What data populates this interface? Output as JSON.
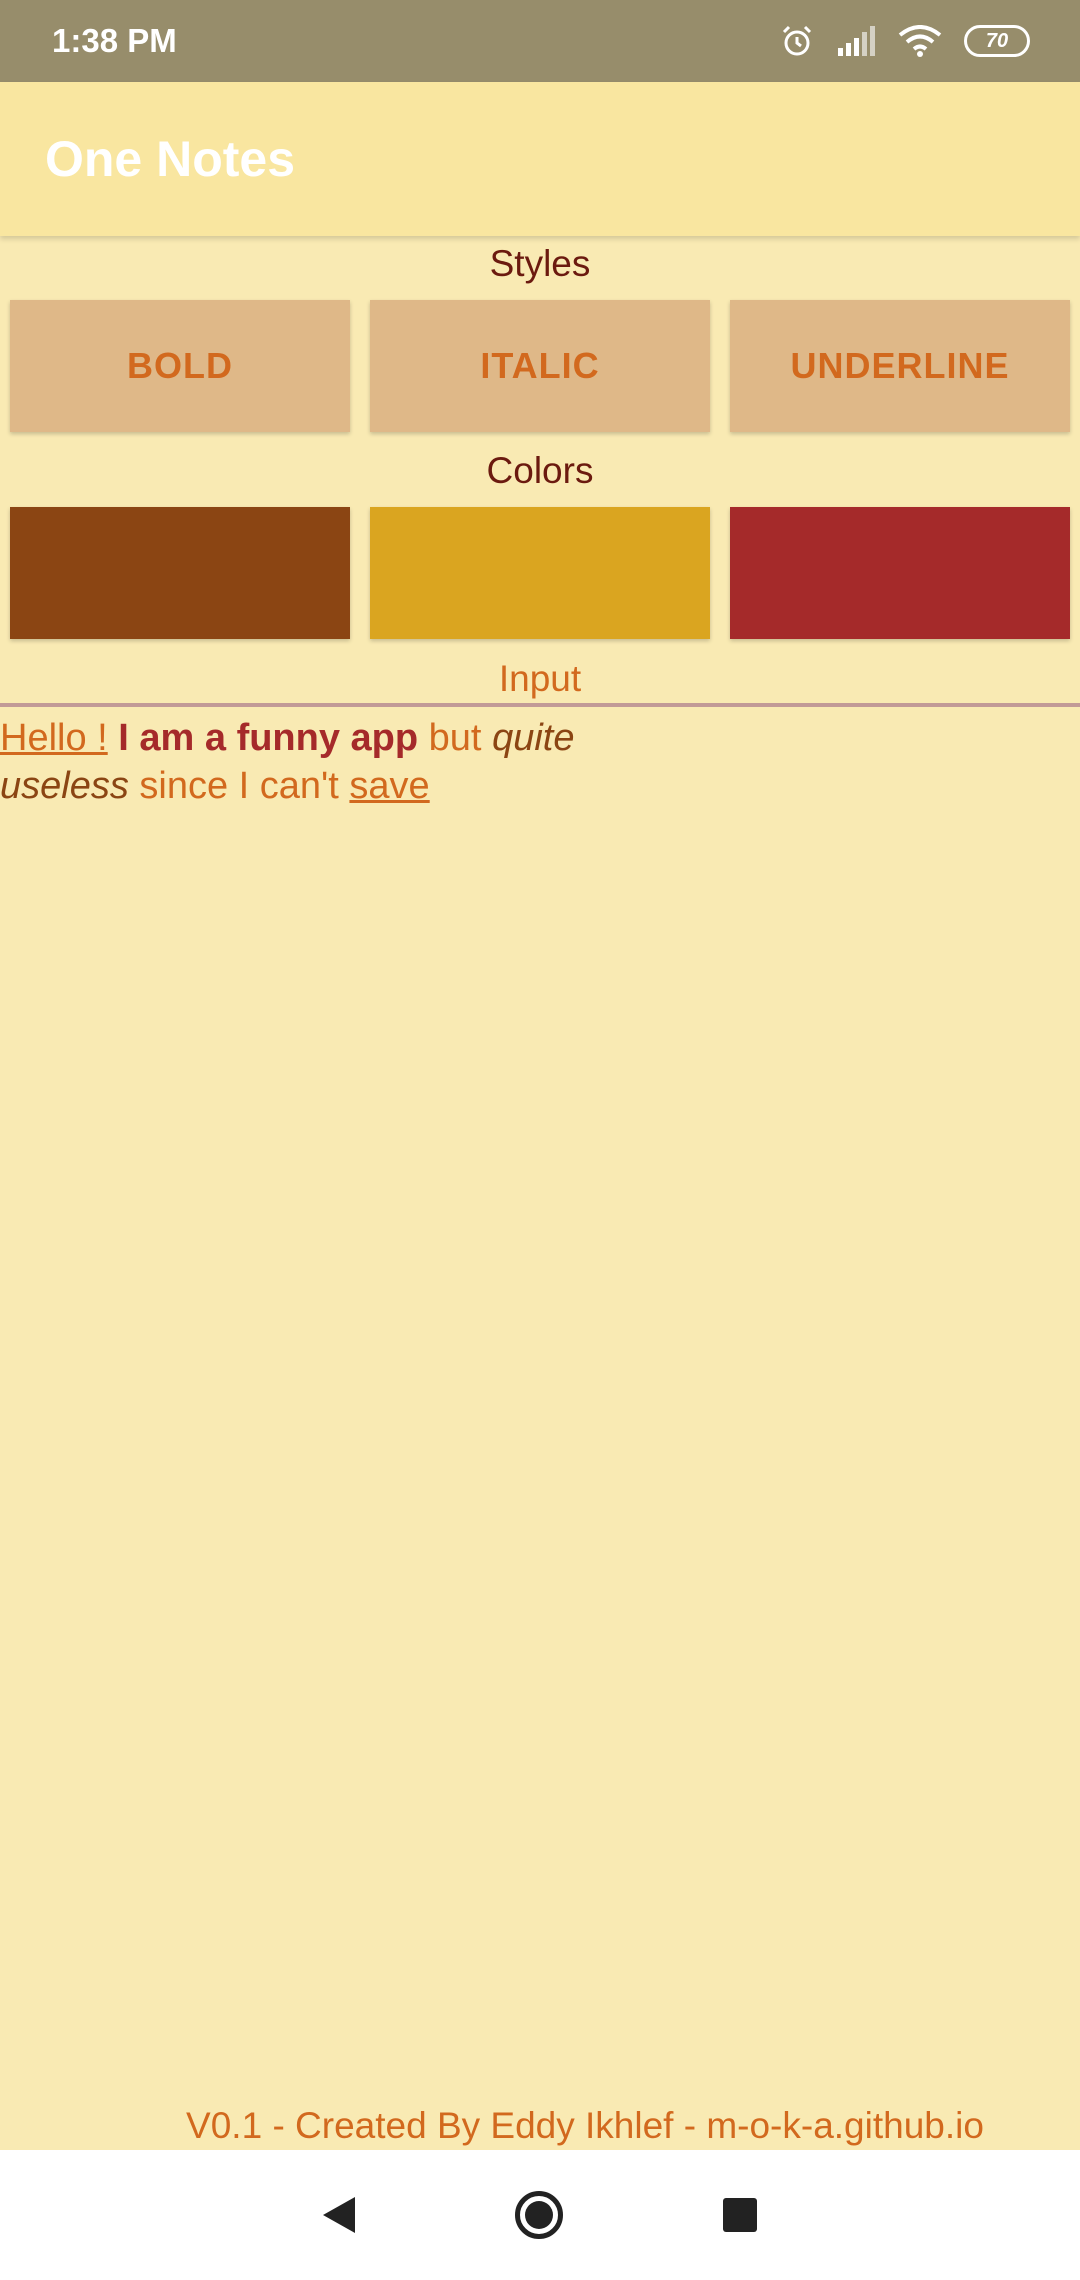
{
  "status_bar": {
    "time": "1:38 PM",
    "battery": "70",
    "icons": [
      "alarm-icon",
      "signal-icon",
      "wifi-icon",
      "battery-icon"
    ]
  },
  "app_bar": {
    "title": "One Notes"
  },
  "styles": {
    "label": "Styles",
    "bold": "BOLD",
    "italic": "ITALIC",
    "underline": "UNDERLINE"
  },
  "colors": {
    "label": "Colors",
    "swatches": [
      "#8B4513",
      "#DAA520",
      "#A52A2A"
    ]
  },
  "input": {
    "label": "Input",
    "content": {
      "seg1": "Hello !",
      "seg2": " ",
      "seg3": "I am a funny app",
      "seg4": " but ",
      "seg5": "quite useless",
      "seg6": " since I can't ",
      "seg7": "save"
    }
  },
  "footer": {
    "text": "V0.1 - Created By Eddy Ikhlef - m-o-k-a.github.io"
  },
  "nav_bar": {
    "icons": [
      "back-icon",
      "home-icon",
      "recents-icon"
    ]
  }
}
